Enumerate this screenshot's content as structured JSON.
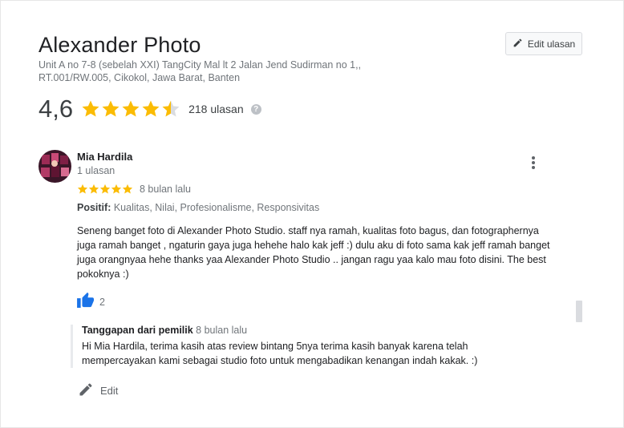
{
  "place": {
    "title": "Alexander Photo",
    "address_line1": "Unit A no 7-8 (sebelah XXI) TangCity Mal lt 2 Jalan Jend Sudirman no 1,,",
    "address_line2": "RT.001/RW.005, Cikokol, Jawa Barat, Banten",
    "edit_button_label": "Edit ulasan",
    "score": "4,6",
    "score_value": 4.6,
    "review_count": "218 ulasan"
  },
  "review": {
    "author": "Mia Hardila",
    "author_reviews": "1 ulasan",
    "stars": 5,
    "time": "8 bulan lalu",
    "positive_label": "Positif:",
    "positive_items": "Kualitas, Nilai, Profesionalisme, Responsivitas",
    "text": "Seneng banget foto di Alexander Photo Studio. staff nya ramah, kualitas foto bagus, dan fotographernya juga ramah banget , ngaturin gaya juga hehehe halo kak jeff :) dulu aku di foto sama kak jeff ramah banget juga orangnyaa hehe thanks yaa Alexander Photo Studio .. jangan ragu yaa kalo mau foto disini. The best pokoknya :)",
    "likes": "2"
  },
  "owner_reply": {
    "label": "Tanggapan dari pemilik",
    "time": "8 bulan lalu",
    "text": "Hi Mia Hardila, terima kasih atas review bintang 5nya terima kasih banyak karena telah mempercayakan kami sebagai studio foto untuk mengabadikan kenangan indah kakak. :)"
  },
  "actions": {
    "edit_label": "Edit"
  },
  "colors": {
    "star": "#fbbc04",
    "star_empty": "#dadce0",
    "like_blue": "#1a73e8"
  },
  "icons": [
    "pencil-icon",
    "star-icon",
    "help-icon",
    "more-vert-icon",
    "thumbs-up-icon"
  ]
}
